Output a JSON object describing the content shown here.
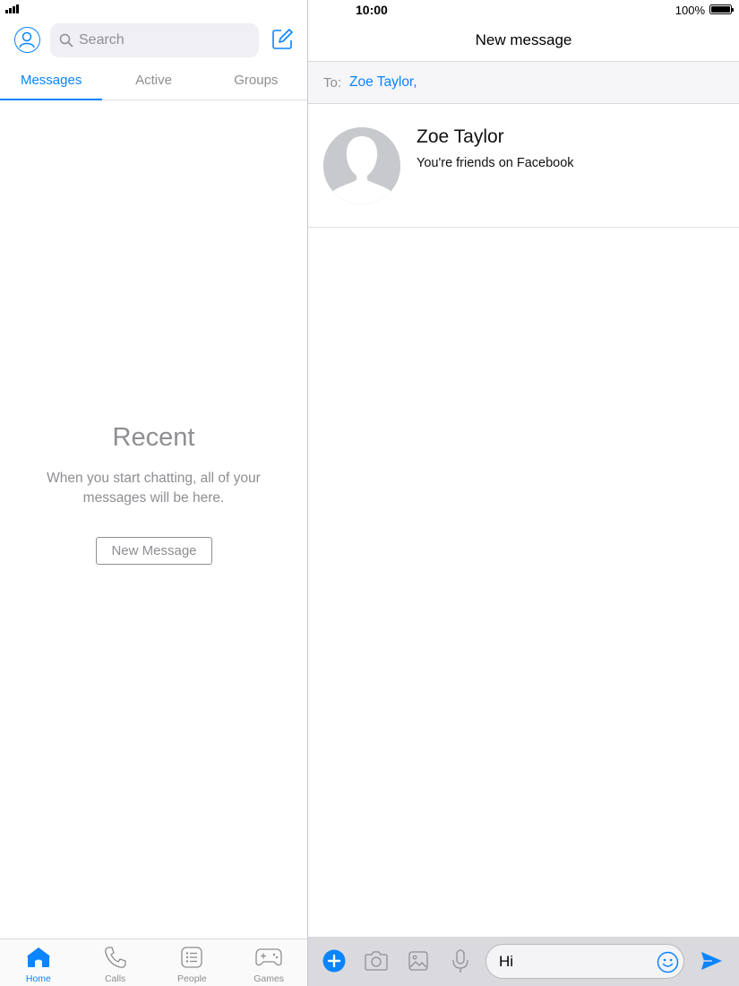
{
  "status_bar": {
    "time": "10:00",
    "battery_percent": "100%",
    "battery_level": 1.0
  },
  "left_pane": {
    "search": {
      "placeholder": "Search",
      "value": ""
    },
    "tabs": [
      {
        "label": "Messages",
        "active": true
      },
      {
        "label": "Active",
        "active": false
      },
      {
        "label": "Groups",
        "active": false
      }
    ],
    "empty_state": {
      "title": "Recent",
      "description": "When you start chatting, all of your messages will be here.",
      "button_label": "New Message"
    },
    "tabbar": [
      {
        "label": "Home",
        "icon": "home-icon",
        "active": true
      },
      {
        "label": "Calls",
        "icon": "phone-icon",
        "active": false
      },
      {
        "label": "People",
        "icon": "people-list-icon",
        "active": false
      },
      {
        "label": "Games",
        "icon": "gamepad-icon",
        "active": false
      }
    ]
  },
  "right_pane": {
    "title": "New message",
    "to_label": "To:",
    "recipient": "Zoe Taylor,",
    "contact": {
      "name": "Zoe Taylor",
      "subtitle": "You're friends on Facebook"
    },
    "composer": {
      "message_value": "Hi",
      "icons": [
        "plus-icon",
        "camera-icon",
        "image-icon",
        "microphone-icon",
        "emoji-icon",
        "send-icon"
      ]
    }
  },
  "colors": {
    "accent": "#0a84ff",
    "muted": "#8e8e93",
    "composer_bg": "#dadade"
  }
}
